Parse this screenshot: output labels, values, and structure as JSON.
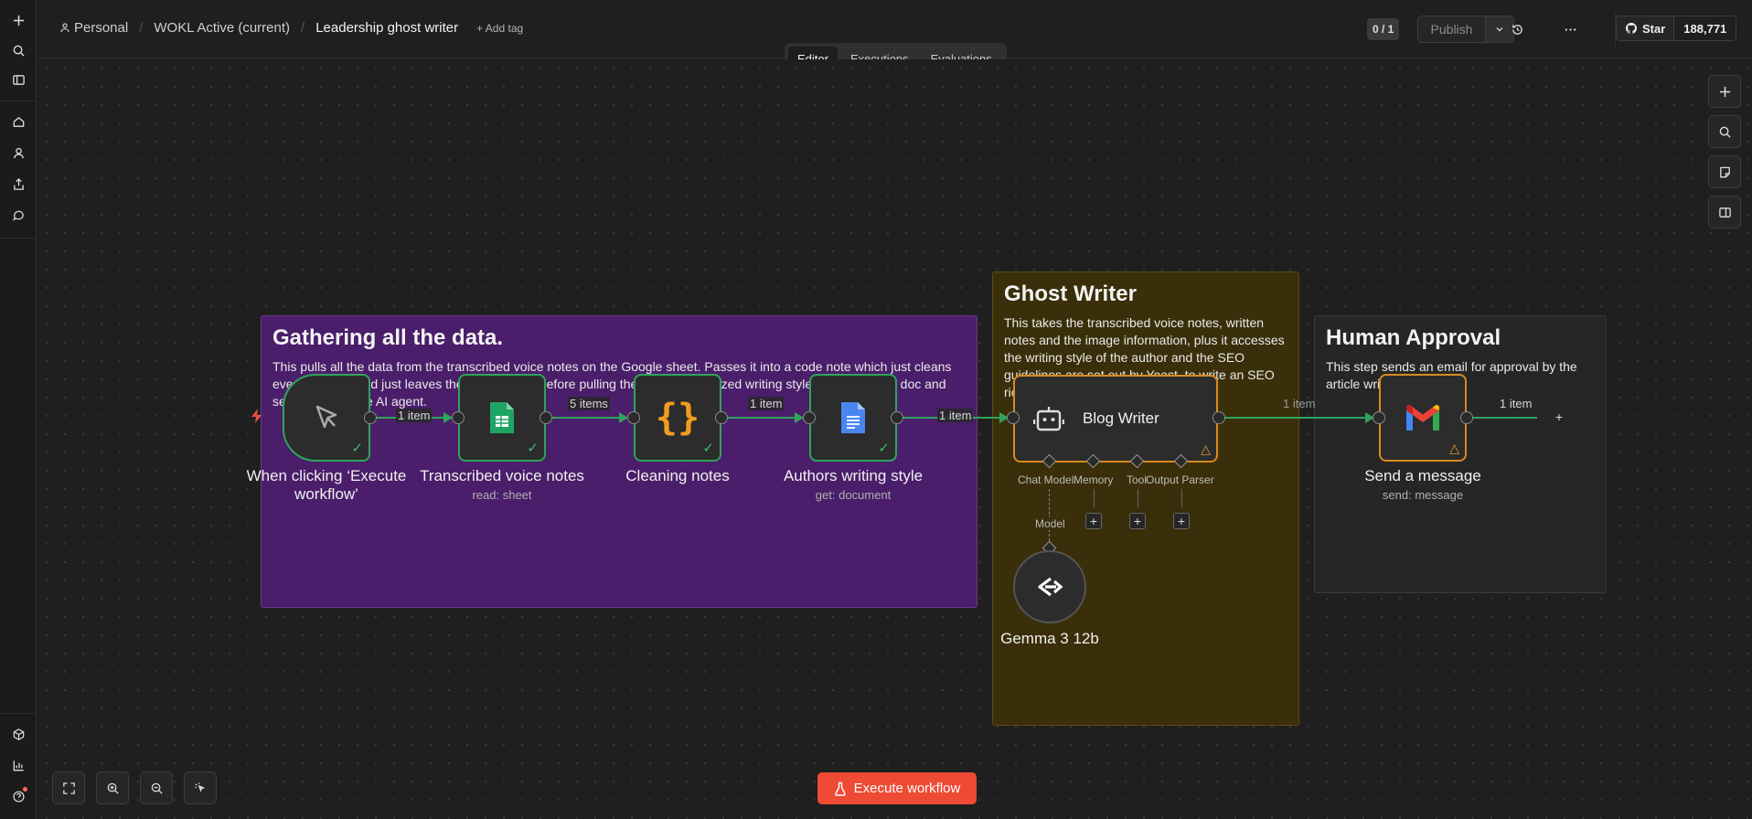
{
  "header": {
    "breadcrumb": [
      "Personal",
      "WOKL Active (current)",
      "Leadership ghost writer"
    ],
    "add_tag": "+ Add tag",
    "counter": "0 / 1",
    "publish": "Publish",
    "github_star": "Star",
    "github_count": "188,771"
  },
  "tabs": [
    "Editor",
    "Executions",
    "Evaluations"
  ],
  "active_tab": "Editor",
  "stickies": {
    "gather": {
      "title": "Gathering all the data.",
      "body": "This pulls all the data from the transcribed voice notes on the Google sheet. Passes it into a code note which just cleans everything out and just leaves the actual notes before pulling the author’s analyzed writing style from a Google doc and sending it into the AI agent."
    },
    "ghost": {
      "title": "Ghost Writer",
      "body": "This takes the transcribed voice notes, written notes and the image information, plus it accesses the writing style of the author and the SEO guidelines are set out by Yoast, to write an SEO rich article for the internet."
    },
    "human": {
      "title": "Human Approval",
      "body": "This step sends an email for approval by the article writer."
    }
  },
  "nodes": {
    "trigger": {
      "label": "When clicking ‘Execute workflow’"
    },
    "sheets": {
      "label": "Transcribed voice notes",
      "sub": "read: sheet"
    },
    "code": {
      "label": "Cleaning notes"
    },
    "docs": {
      "label": "Authors writing style",
      "sub": "get: document"
    },
    "agent": {
      "label": "Blog Writer"
    },
    "gmail": {
      "label": "Send a message",
      "sub": "send: message"
    },
    "model": {
      "label": "Gemma 3 12b"
    }
  },
  "edges": {
    "e1": "1 item",
    "e2": "5 items",
    "e3": "1 item",
    "e4": "1 item",
    "e5": "1 item",
    "e6": "1 item"
  },
  "agent_inputs": {
    "chat_model": "Chat Model",
    "memory": "Memory",
    "tool": "Tool",
    "output_parser": "Output Parser",
    "model": "Model"
  },
  "execute_button": "Execute workflow",
  "colors": {
    "accent": "#ee4a34",
    "success": "#2fa35b",
    "warning": "#d98a1f",
    "sticky_purple": "#4a1e6a",
    "sticky_yellow": "#3a2f0a"
  }
}
